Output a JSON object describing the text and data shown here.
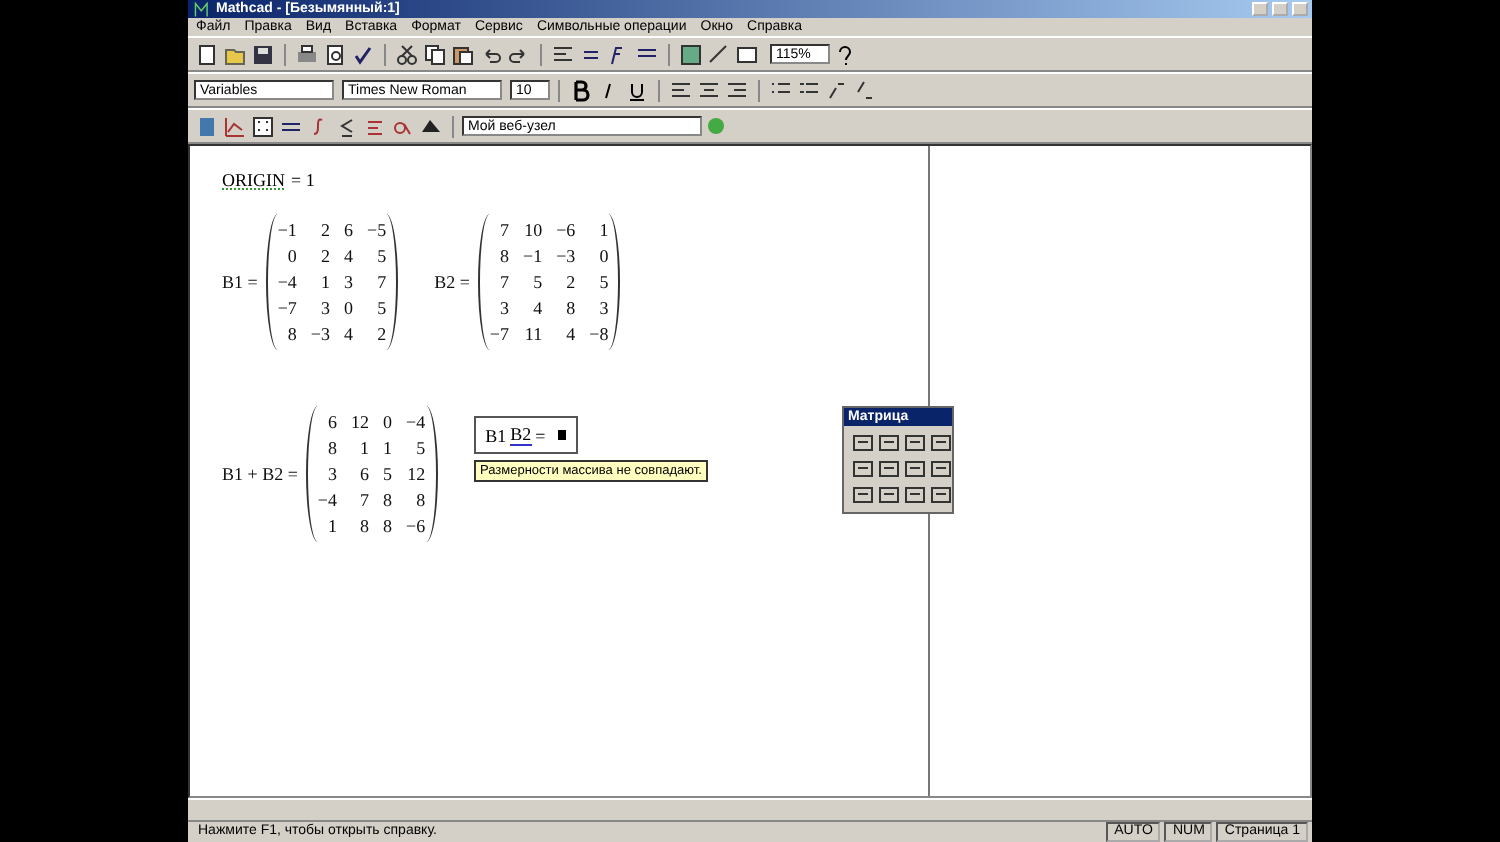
{
  "window": {
    "title": "Mathcad - [Безымянный:1]"
  },
  "menu": [
    "Файл",
    "Правка",
    "Вид",
    "Вставка",
    "Формат",
    "Сервис",
    "Символьные операции",
    "Окно",
    "Справка"
  ],
  "toolbar": {
    "zoom": "115%"
  },
  "format_bar": {
    "style": "Variables",
    "font": "Times New Roman",
    "size": "10"
  },
  "resource_bar": {
    "address": "Мой веб-узел"
  },
  "worksheet": {
    "origin": {
      "name": "ORIGIN",
      "value": "= 1"
    },
    "definitions": [
      {
        "name": "B1 =",
        "rows": [
          [
            "−1",
            "2",
            "6",
            "−5"
          ],
          [
            "0",
            "2",
            "4",
            "5"
          ],
          [
            "−4",
            "1",
            "3",
            "7"
          ],
          [
            "−7",
            "3",
            "0",
            "5"
          ],
          [
            "8",
            "−3",
            "4",
            "2"
          ]
        ]
      },
      {
        "name": "B2 =",
        "rows": [
          [
            "7",
            "10",
            "−6",
            "1"
          ],
          [
            "8",
            "−1",
            "−3",
            "0"
          ],
          [
            "7",
            "5",
            "2",
            "5"
          ],
          [
            "3",
            "4",
            "8",
            "3"
          ],
          [
            "−7",
            "11",
            "4",
            "−8"
          ]
        ]
      }
    ],
    "sum": {
      "name": "B1 + B2 =",
      "rows": [
        [
          "6",
          "12",
          "0",
          "−4"
        ],
        [
          "8",
          "1",
          "1",
          "5"
        ],
        [
          "3",
          "6",
          "5",
          "12"
        ],
        [
          "−4",
          "7",
          "8",
          "8"
        ],
        [
          "1",
          "8",
          "8",
          "−6"
        ]
      ]
    },
    "evaluation": {
      "left": "B1",
      "right": "B2",
      "equals": "=",
      "error": "Размерности массива не совпадают."
    }
  },
  "palette": {
    "title": "Матрица"
  },
  "status_bar": {
    "message": "Нажмите F1, чтобы открыть справку.",
    "mode": "AUTO",
    "num": "NUM",
    "page": "Страница 1"
  }
}
